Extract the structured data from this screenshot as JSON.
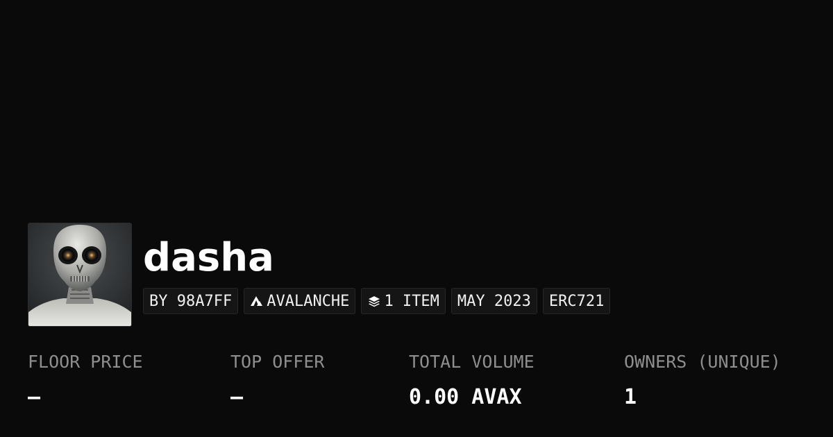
{
  "collection": {
    "name": "dasha",
    "avatar_icon": "alien-skull-avatar"
  },
  "tags": {
    "creator": "BY 98A7FF",
    "chain": "AVALANCHE",
    "chain_icon": "avalanche-logo-icon",
    "items": "1 ITEM",
    "items_icon": "layers-icon",
    "date": "MAY 2023",
    "standard": "ERC721"
  },
  "stats": {
    "floor_price": {
      "label": "FLOOR PRICE",
      "value": "—"
    },
    "top_offer": {
      "label": "TOP OFFER",
      "value": "—"
    },
    "total_volume": {
      "label": "TOTAL VOLUME",
      "value": "0.00 AVAX"
    },
    "owners": {
      "label": "OWNERS (UNIQUE)",
      "value": "1"
    }
  },
  "colors": {
    "background": "#0a0a0a",
    "text": "#ffffff",
    "muted": "#8e8e8e",
    "tag_bg": "#151515"
  }
}
